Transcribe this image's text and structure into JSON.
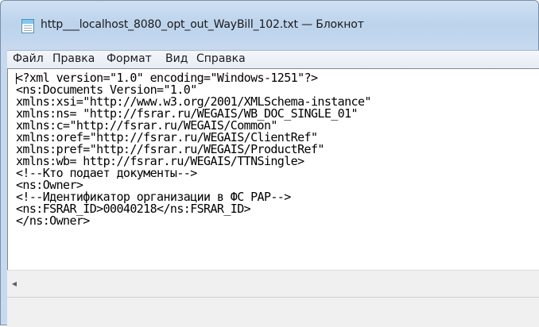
{
  "window": {
    "title": "http___localhost_8080_opt_out_WayBill_102.txt — Блокнот",
    "icon": "notepad-icon"
  },
  "menu": {
    "items": [
      "Файл",
      "Правка",
      "Формат",
      "Вид",
      "Справка"
    ]
  },
  "editor": {
    "lines": [
      "<?xml version=\"1.0\" encoding=\"Windows-1251\"?>",
      "<ns:Documents Version=\"1.0\"",
      "xmlns:xsi=\"http://www.w3.org/2001/XMLSchema-instance\"",
      "xmlns:ns= \"http://fsrar.ru/WEGAIS/WB_DOC_SINGLE_01\"",
      "xmlns:c=\"http://fsrar.ru/WEGAIS/Common\"",
      "xmlns:oref=\"http://fsrar.ru/WEGAIS/ClientRef\"",
      "xmlns:pref=\"http://fsrar.ru/WEGAIS/ProductRef\"",
      "xmlns:wb= http://fsrar.ru/WEGAIS/TTNSingle>",
      "<!--Кто подает документы-->",
      "<ns:Owner>",
      "<!--Идентификатор организации в ФС РАР-->",
      "<ns:FSRAR_ID>00040218</ns:FSRAR_ID>",
      "</ns:Owner>"
    ]
  },
  "scrollbar": {
    "left_arrow": "◀"
  }
}
